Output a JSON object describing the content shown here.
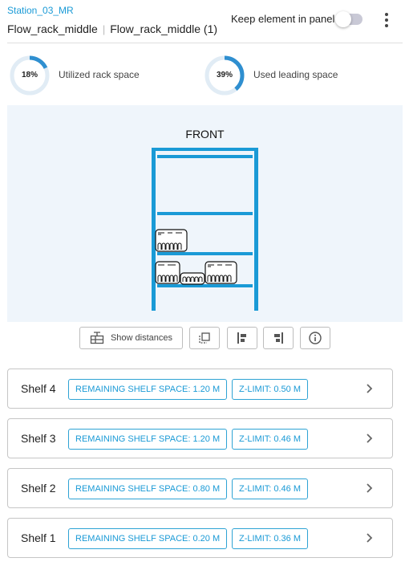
{
  "header": {
    "station": "Station_03_MR",
    "rack_name": "Flow_rack_middle",
    "rack_instance": "Flow_rack_middle (1)",
    "separator": "|",
    "keep_label": "Keep element in panel",
    "keep_enabled": false
  },
  "stats": [
    {
      "percent_label": "18%",
      "percent": 18,
      "label": "Utilized rack space"
    },
    {
      "percent_label": "39%",
      "percent": 39,
      "label": "Used leading space"
    }
  ],
  "visualization": {
    "front_label": "FRONT",
    "rack_color": "#1a9ad6"
  },
  "toolbar": {
    "show_distances_label": "Show distances",
    "buttons": [
      "show-distances",
      "crop-select",
      "align-left",
      "align-right",
      "info"
    ]
  },
  "shelves": [
    {
      "name": "Shelf 4",
      "remaining": "REMAINING SHELF SPACE: 1.20 M",
      "zlimit": "Z-LIMIT: 0.50 M"
    },
    {
      "name": "Shelf 3",
      "remaining": "REMAINING SHELF SPACE: 1.20 M",
      "zlimit": "Z-LIMIT: 0.46 M"
    },
    {
      "name": "Shelf 2",
      "remaining": "REMAINING SHELF SPACE: 0.80 M",
      "zlimit": "Z-LIMIT: 0.46 M"
    },
    {
      "name": "Shelf 1",
      "remaining": "REMAINING SHELF SPACE: 0.20 M",
      "zlimit": "Z-LIMIT: 0.36 M"
    }
  ],
  "colors": {
    "accent": "#1a9ad6",
    "gauge_track": "#e1ecf5",
    "panel_bg": "#eff5fb"
  },
  "icons": {
    "more": "kebab-menu-icon",
    "chevron": "chevron-right-icon",
    "info": "info-icon"
  }
}
